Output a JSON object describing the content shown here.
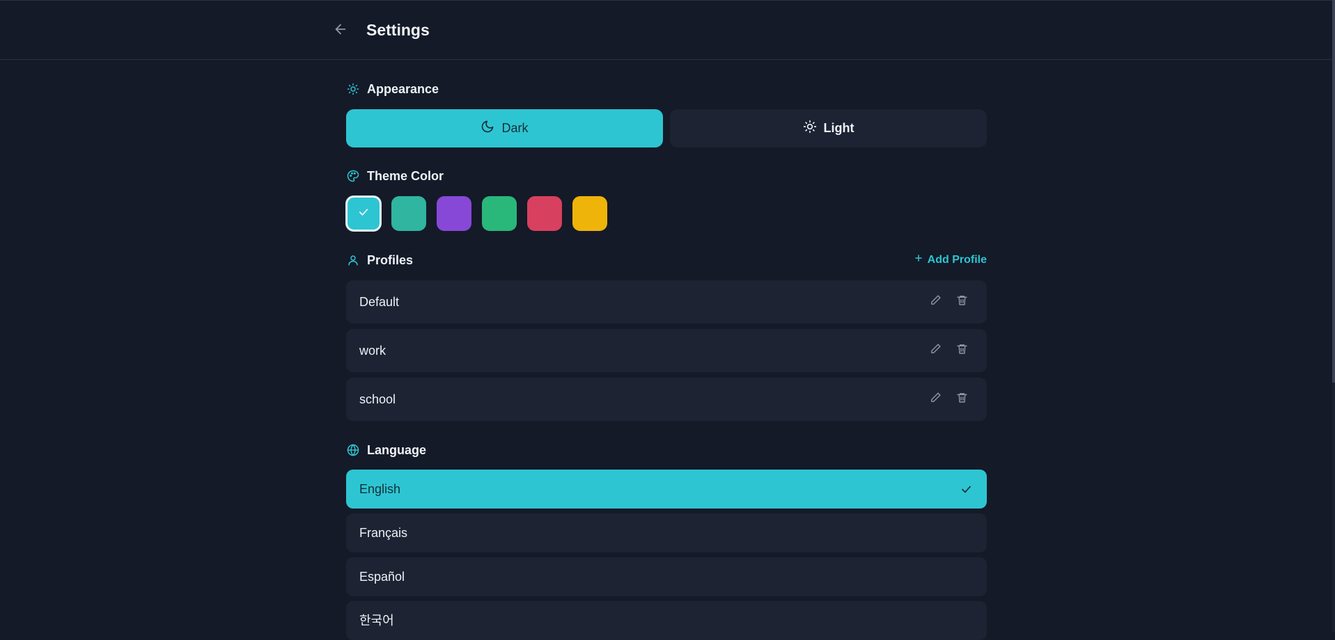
{
  "header": {
    "title": "Settings",
    "back_icon": "arrow-left-icon"
  },
  "appearance": {
    "heading": "Appearance",
    "dark_label": "Dark",
    "light_label": "Light",
    "selected": "Dark"
  },
  "theme_color": {
    "heading": "Theme Color",
    "swatches": [
      {
        "color": "#2ec5d3",
        "selected": true
      },
      {
        "color": "#2fb5a0",
        "selected": false
      },
      {
        "color": "#8748d8",
        "selected": false
      },
      {
        "color": "#2ab77a",
        "selected": false
      },
      {
        "color": "#d8405f",
        "selected": false
      },
      {
        "color": "#efb40a",
        "selected": false
      }
    ]
  },
  "profiles": {
    "heading": "Profiles",
    "add_label": "Add Profile",
    "items": [
      {
        "name": "Default"
      },
      {
        "name": "work"
      },
      {
        "name": "school"
      }
    ]
  },
  "language": {
    "heading": "Language",
    "items": [
      {
        "name": "English",
        "selected": true
      },
      {
        "name": "Français",
        "selected": false
      },
      {
        "name": "Español",
        "selected": false
      },
      {
        "name": "한국어",
        "selected": false
      }
    ]
  },
  "colors": {
    "accent": "#2ec5d3",
    "background": "#141a27",
    "surface": "#1d2333"
  }
}
